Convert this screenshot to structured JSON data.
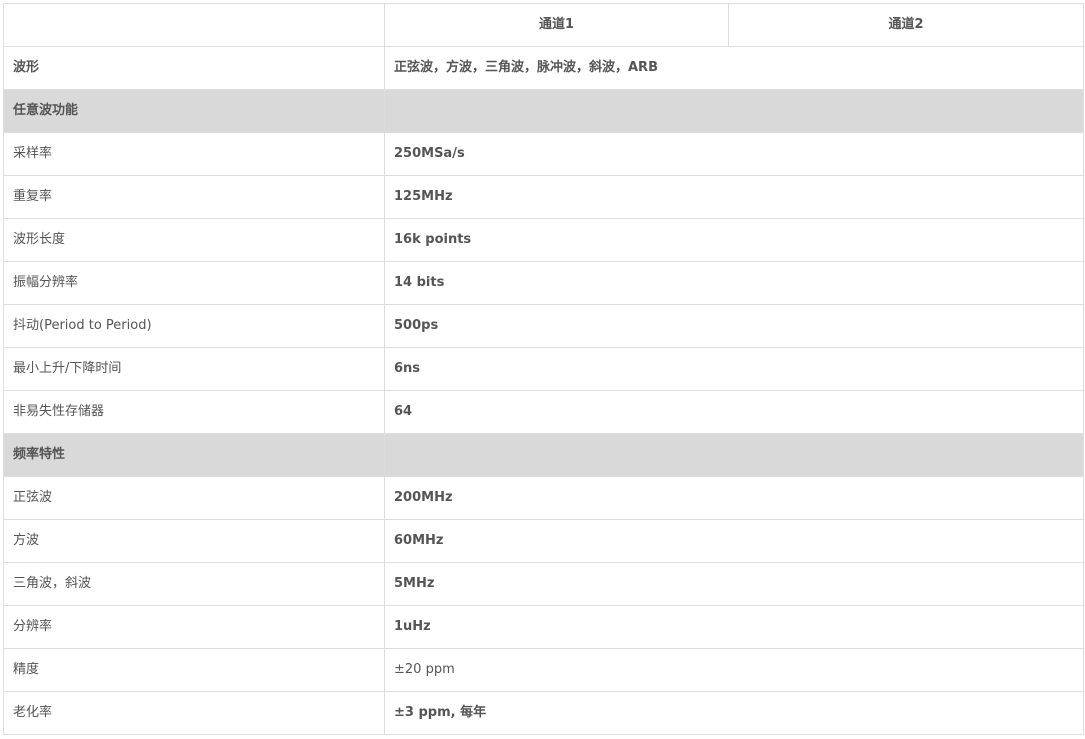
{
  "header": {
    "corner": "",
    "channels": [
      "通道1",
      "通道2"
    ]
  },
  "rows": [
    {
      "type": "bold",
      "label": "波形",
      "value": "正弦波，方波，三角波，脉冲波，斜波，ARB"
    },
    {
      "type": "section",
      "label": "任意波功能",
      "value": ""
    },
    {
      "type": "row",
      "label": "采样率",
      "value": "250MSa/s"
    },
    {
      "type": "row",
      "label": "重复率",
      "value": "125MHz"
    },
    {
      "type": "row",
      "label": "波形长度",
      "value": "16k points"
    },
    {
      "type": "row",
      "label": "振幅分辨率",
      "value": "14 bits"
    },
    {
      "type": "row",
      "label": "抖动(Period to Period)",
      "value": "500ps"
    },
    {
      "type": "row",
      "label": "最小上升/下降时间",
      "value": "6ns"
    },
    {
      "type": "row",
      "label": "非易失性存储器",
      "value": "64"
    },
    {
      "type": "section",
      "label": "频率特性",
      "value": ""
    },
    {
      "type": "row",
      "label": "正弦波",
      "value": "200MHz"
    },
    {
      "type": "row",
      "label": "方波",
      "value": "60MHz"
    },
    {
      "type": "row",
      "label": "三角波，斜波",
      "value": "5MHz"
    },
    {
      "type": "row",
      "label": "分辨率",
      "value": "1uHz"
    },
    {
      "type": "plain",
      "label": "精度",
      "value": "±20 ppm"
    },
    {
      "type": "row",
      "label": "老化率",
      "value": "±3 ppm, 每年"
    }
  ]
}
